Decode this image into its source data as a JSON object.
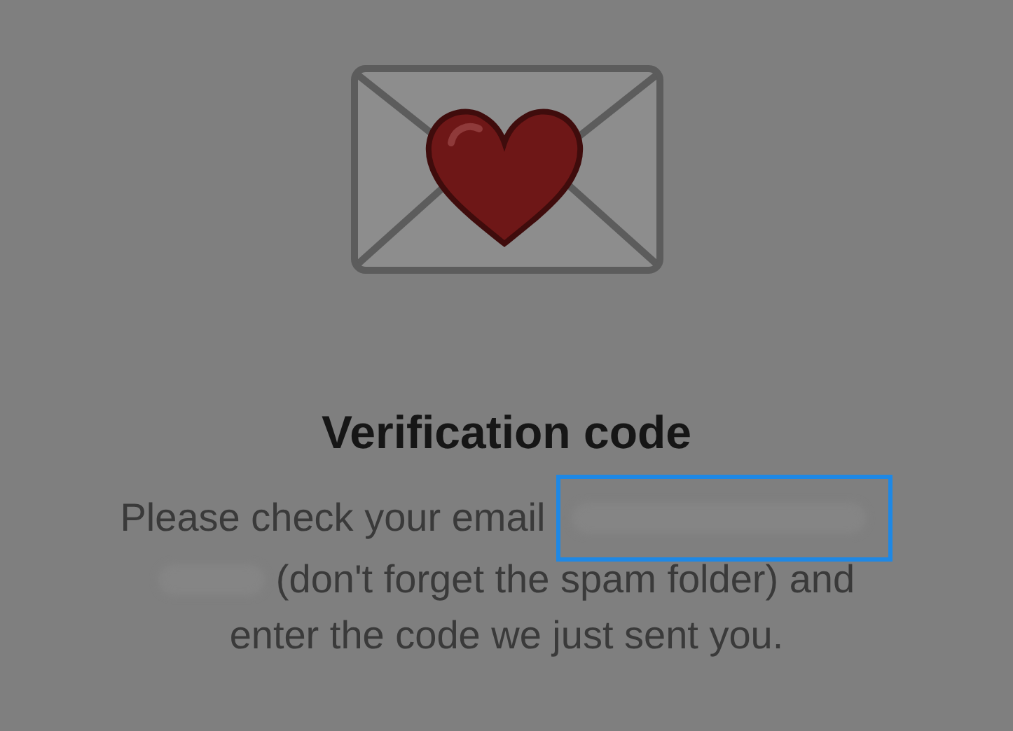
{
  "title": "Verification code",
  "message": {
    "line_1": "Please check your email",
    "line_2": "(don't forget the spam folder) and",
    "line_3": "enter the code we just sent you."
  },
  "email": {
    "highlighted": true
  }
}
